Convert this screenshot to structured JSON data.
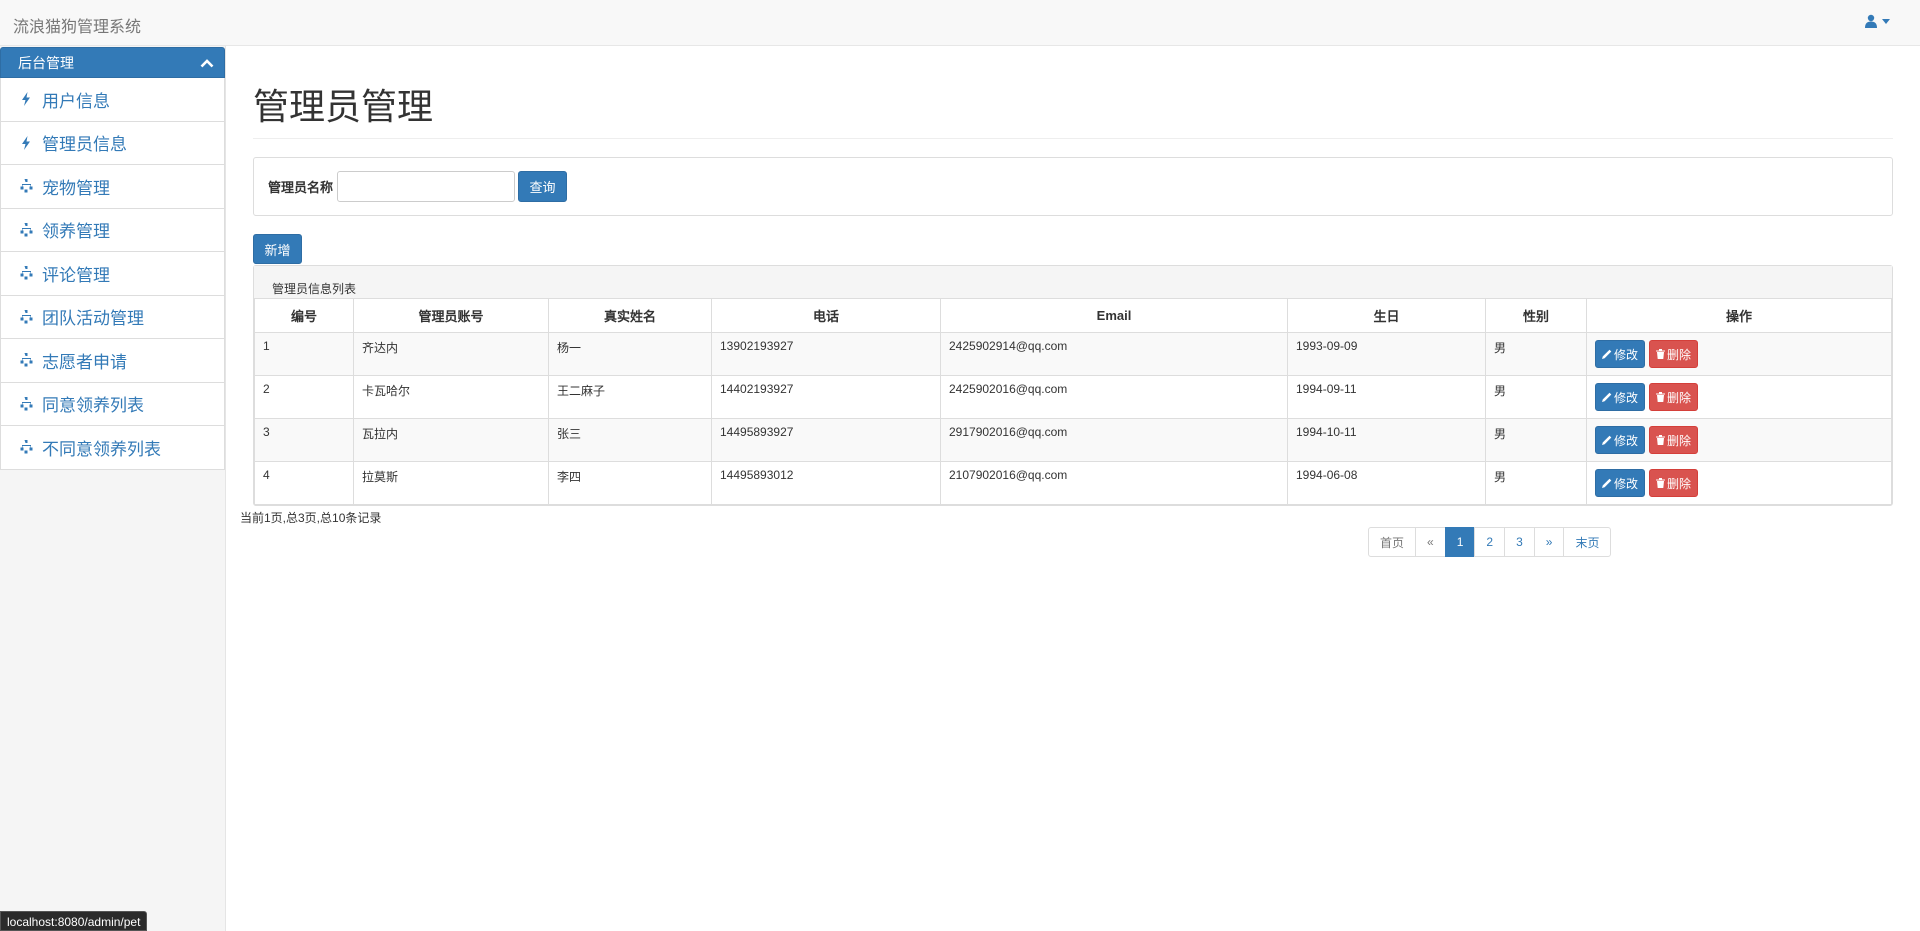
{
  "app": {
    "brand": "流浪猫狗管理系统"
  },
  "sidebar": {
    "header": "后台管理",
    "items": [
      {
        "label": "用户信息",
        "icon": "bolt-icon"
      },
      {
        "label": "管理员信息",
        "icon": "bolt-icon"
      },
      {
        "label": "宠物管理",
        "icon": "sitemap-icon"
      },
      {
        "label": "领养管理",
        "icon": "sitemap-icon"
      },
      {
        "label": "评论管理",
        "icon": "sitemap-icon"
      },
      {
        "label": "团队活动管理",
        "icon": "sitemap-icon"
      },
      {
        "label": "志愿者申请",
        "icon": "sitemap-icon"
      },
      {
        "label": "同意领养列表",
        "icon": "sitemap-icon"
      },
      {
        "label": "不同意领养列表",
        "icon": "sitemap-icon"
      }
    ]
  },
  "main": {
    "title": "管理员管理",
    "search": {
      "label": "管理员名称",
      "value": "",
      "placeholder": "",
      "button": "查询"
    },
    "add_button": "新增",
    "table": {
      "caption": "管理员信息列表",
      "columns": [
        "编号",
        "管理员账号",
        "真实姓名",
        "电话",
        "Email",
        "生日",
        "性别",
        "操作"
      ],
      "rows": [
        [
          "1",
          "齐达内",
          "杨一",
          "13902193927",
          "2425902914@qq.com",
          "1993-09-09",
          "男"
        ],
        [
          "2",
          "卡瓦哈尔",
          "王二麻子",
          "14402193927",
          "2425902016@qq.com",
          "1994-09-11",
          "男"
        ],
        [
          "3",
          "瓦拉内",
          "张三",
          "14495893927",
          "2917902016@qq.com",
          "1994-10-11",
          "男"
        ],
        [
          "4",
          "拉莫斯",
          "李四",
          "14495893012",
          "2107902016@qq.com",
          "1994-06-08",
          "男"
        ]
      ],
      "edit_label": "修改",
      "delete_label": "删除"
    },
    "pager": {
      "info": "当前1页,总3页,总10条记录",
      "first": "首页",
      "prev": "«",
      "pages": [
        "1",
        "2",
        "3"
      ],
      "current": "1",
      "next": "»",
      "last": "末页"
    }
  },
  "status_bar": {
    "url": "localhost:8080/admin/pet"
  },
  "colors": {
    "primary": "#337ab7",
    "danger": "#d9534f"
  }
}
